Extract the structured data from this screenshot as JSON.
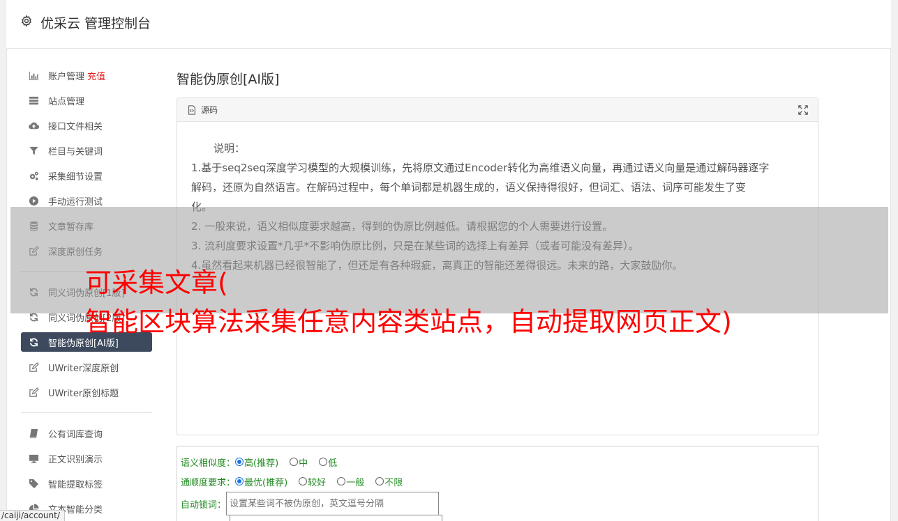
{
  "header": {
    "title": "优采云 管理控制台",
    "icon": "gear-icon"
  },
  "sidebar": {
    "group1": [
      {
        "label": "账户管理",
        "badge": "充值",
        "icon": "bar-chart-icon"
      },
      {
        "label": "站点管理",
        "icon": "server-icon"
      },
      {
        "label": "接口文件相关",
        "icon": "cloud-upload-icon"
      },
      {
        "label": "栏目与关键词",
        "icon": "filter-icon"
      },
      {
        "label": "采集细节设置",
        "icon": "gears-icon"
      },
      {
        "label": "手动运行测试",
        "icon": "play-circle-icon"
      },
      {
        "label": "文章暂存库",
        "icon": "database-icon"
      },
      {
        "label": "深度原创任务",
        "icon": "edit-icon"
      }
    ],
    "group2": [
      {
        "label": "同义词伪原创[1版]",
        "icon": "refresh-icon"
      },
      {
        "label": "同义词伪原创[2版]",
        "icon": "refresh-icon"
      },
      {
        "label": "智能伪原创[AI版]",
        "icon": "refresh-icon",
        "active": true
      },
      {
        "label": "UWriter深度原创",
        "icon": "edit-icon"
      },
      {
        "label": "UWriter原创标题",
        "icon": "edit-icon"
      }
    ],
    "group3": [
      {
        "label": "公有词库查询",
        "icon": "book-icon"
      },
      {
        "label": "正文识别演示",
        "icon": "monitor-icon"
      },
      {
        "label": "智能提取标签",
        "icon": "tag-icon"
      },
      {
        "label": "文本智能分类",
        "icon": "pie-chart-icon"
      }
    ]
  },
  "main": {
    "title": "智能伪原创[AI版]",
    "panel": {
      "header": "源码",
      "note_title": "说明：",
      "lines": [
        "1.基于seq2seq深度学习模型的大规模训练，先将原文通过Encoder转化为高维语义向量，再通过语义向量是通过解码器逐字",
        "解码，还原为自然语言。在解码过程中，每个单词都是机器生成的，语义保持得很好，但词汇、语法、词序可能发生了变",
        "化。",
        "2. 一般来说，语义相似度要求越高，得到的伪原比例越低。请根据您的个人需要进行设置。",
        "3. 流利度要求设置*几乎*不影响伪原比例，只是在某些词的选择上有差异（或者可能没有差异）。",
        "4.虽然看起来机器已经很智能了，但还是有各种瑕疵，离真正的智能还差得很远。未来的路，大家鼓励你。"
      ]
    },
    "form": {
      "similarity": {
        "label": "语义相似度：",
        "options": [
          "高(推荐)",
          "中",
          "低"
        ],
        "selected": 0
      },
      "fluency": {
        "label": "通顺度要求：",
        "options": [
          "最优(推荐)",
          "较好",
          "一般",
          "不限"
        ],
        "selected": 0
      },
      "lock": {
        "label": "自动锁词：",
        "placeholder": "设置某些词不被伪原创，英文逗号分隔"
      }
    }
  },
  "overlay": {
    "line1": "可采集文章(",
    "line2": "智能区块算法采集任意内容类站点，自动提取网页正文)"
  },
  "status_url": "/caiji/account/",
  "colors": {
    "active_bg": "#3d4a5e",
    "badge": "#e02020",
    "form_label": "#228b22",
    "overlay_text": "#ff0000"
  }
}
